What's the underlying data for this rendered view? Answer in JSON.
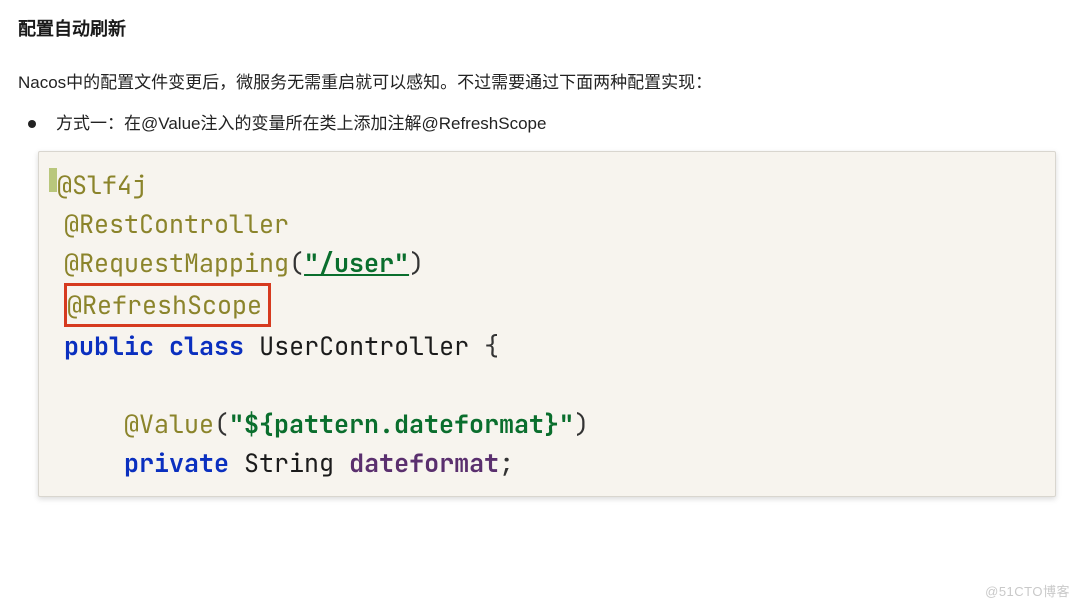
{
  "heading": "配置自动刷新",
  "paragraph": "Nacos中的配置文件变更后，微服务无需重启就可以感知。不过需要通过下面两种配置实现：",
  "bullet": "方式一：在@Value注入的变量所在类上添加注解@RefreshScope",
  "code": {
    "slf4j": "@Slf4j",
    "restController": "@RestController",
    "requestMapping_ann": "@RequestMapping",
    "requestMapping_arg": "\"/user\"",
    "refreshScope": "@RefreshScope",
    "public": "public",
    "class": "class",
    "className": "UserController",
    "lbrace": "{",
    "value_ann": "@Value",
    "value_arg": "\"${pattern.dateformat}\"",
    "private": "private",
    "string": "String",
    "field": "dateformat",
    "semi": ";",
    "lparen": "(",
    "rparen": ")"
  },
  "watermark": "@51CTO博客"
}
